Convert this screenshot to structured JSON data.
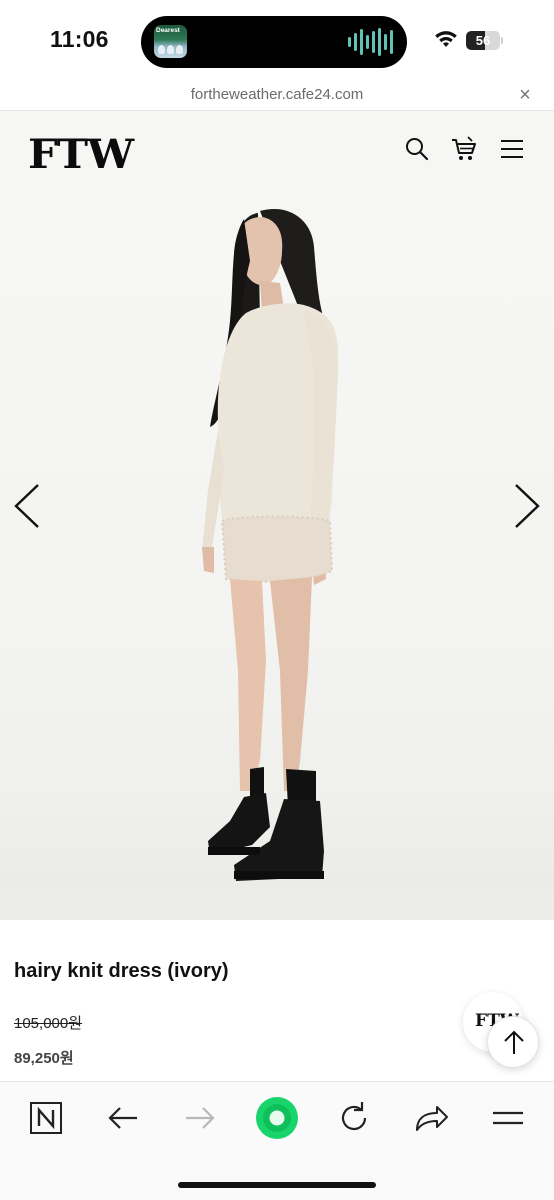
{
  "status_bar": {
    "time": "11:06",
    "now_playing_art_text": "Dearest",
    "battery_level": "56",
    "battery_fraction": 0.56
  },
  "browser": {
    "url": "fortheweather.cafe24.com",
    "close_glyph": "×"
  },
  "site": {
    "logo": "FTW",
    "icons": [
      "search-icon",
      "cart-icon",
      "menu-icon"
    ]
  },
  "gallery": {
    "prev_icon": "chevron-left-icon",
    "next_icon": "chevron-right-icon"
  },
  "product": {
    "name": "hairy knit dress (ivory)",
    "original_price": "105,000원",
    "sale_price": "89,250원"
  },
  "floating": {
    "brand_badge": "FTW",
    "scroll_top_icon": "arrow-up-icon"
  },
  "toolbar": {
    "items": [
      "naver-home-icon",
      "back-icon",
      "forward-icon",
      "green-dot-icon",
      "reload-icon",
      "share-icon",
      "menu-icon"
    ],
    "accent_color": "#03c75a"
  }
}
